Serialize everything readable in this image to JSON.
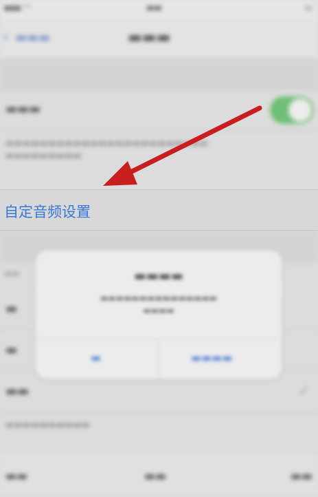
{
  "highlight_row": {
    "label": "自定音频设置"
  },
  "colors": {
    "highlight_text": "#3a78d6",
    "arrow": "#c81e1e",
    "toggle_on": "#6fbf75"
  }
}
